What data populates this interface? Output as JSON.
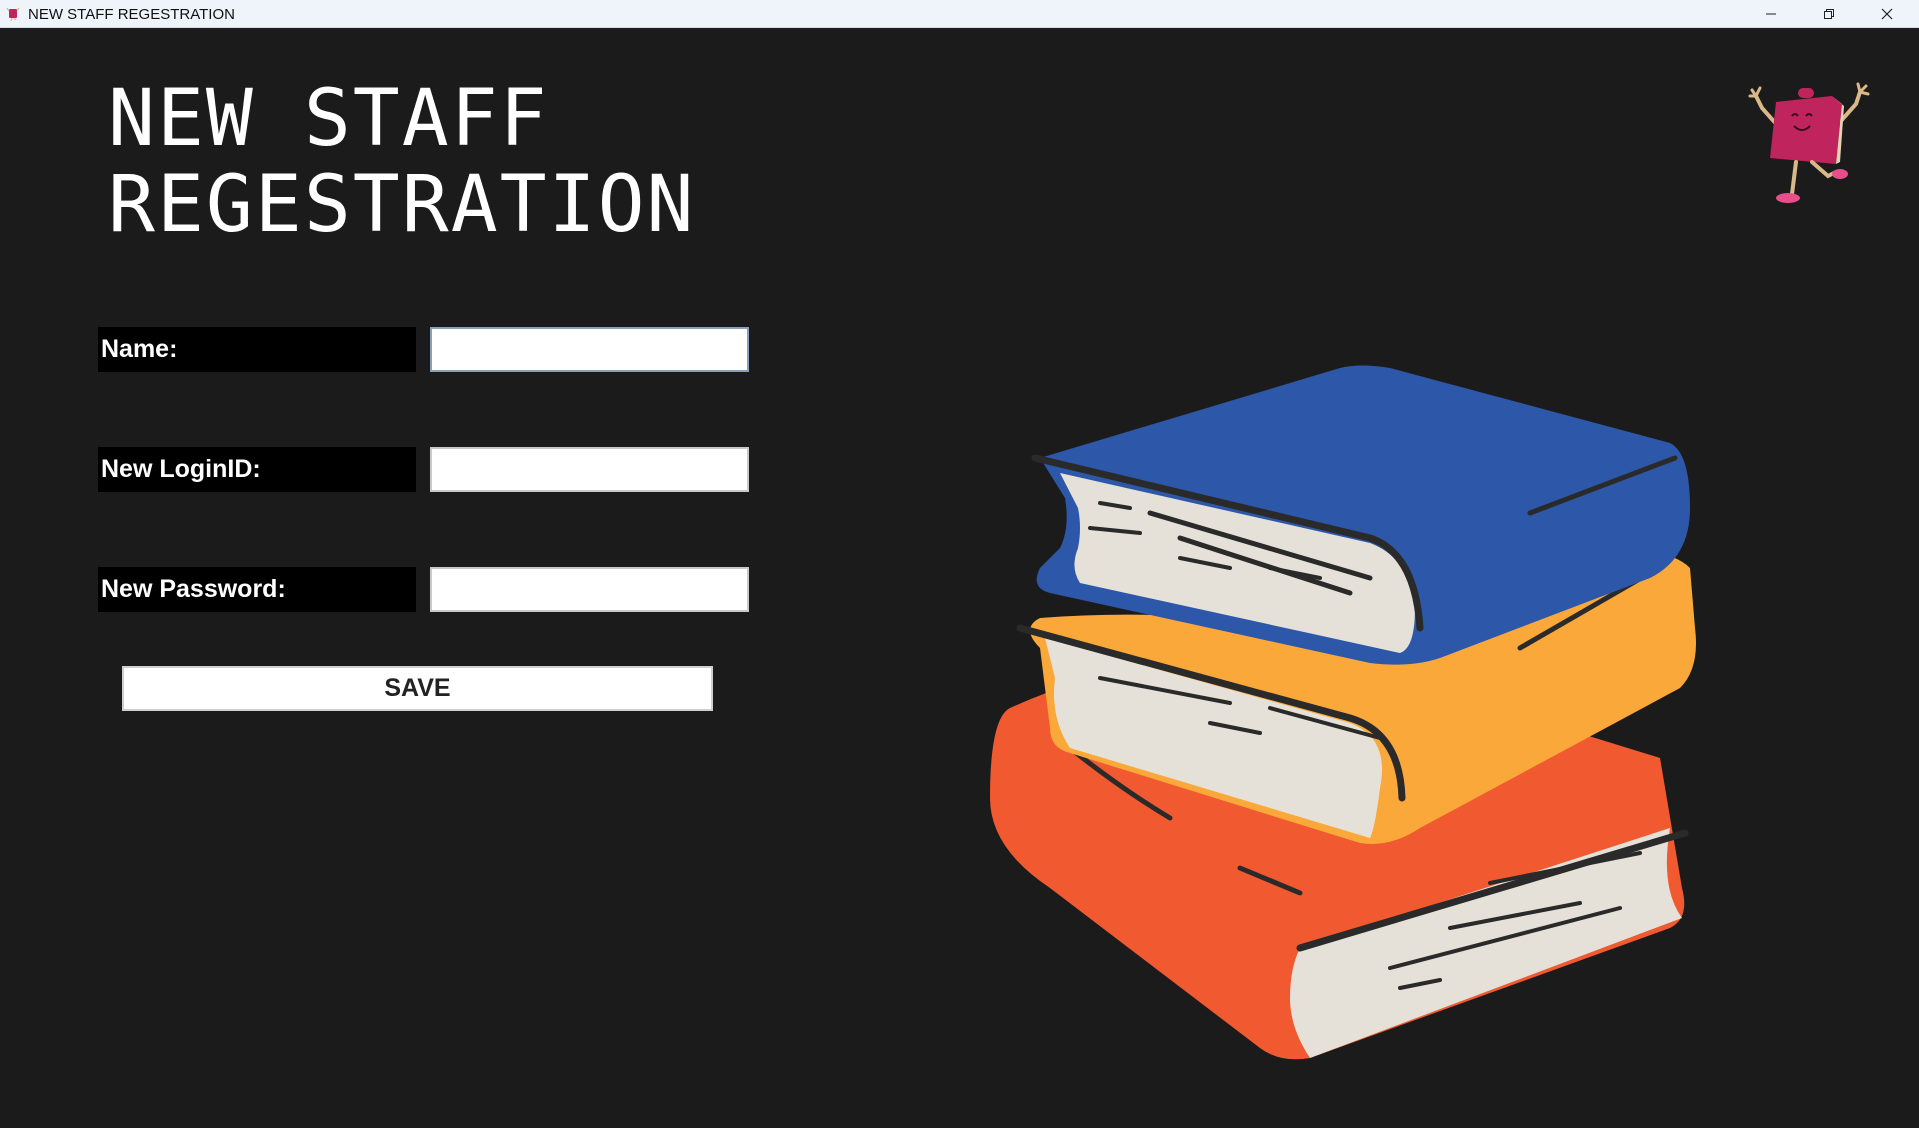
{
  "window": {
    "title": "NEW STAFF REGESTRATION",
    "icon": "book-mascot-icon",
    "controls": [
      "minimize-icon",
      "restore-icon",
      "close-icon"
    ]
  },
  "heading": {
    "line1": "NEW STAFF",
    "line2": "REGESTRATION"
  },
  "form": {
    "name_label": "Name:",
    "name_value": "",
    "login_label": "New LoginID:",
    "login_value": "",
    "password_label": "New Password:",
    "password_value": "",
    "save_label": "SAVE"
  },
  "colors": {
    "background": "#1b1b1b",
    "label_bg": "#000000",
    "book_blue": "#2d57a8",
    "book_orange": "#fba83a",
    "book_red": "#f15a30",
    "pages": "#e5e1d8",
    "mascot": "#c0245c"
  }
}
